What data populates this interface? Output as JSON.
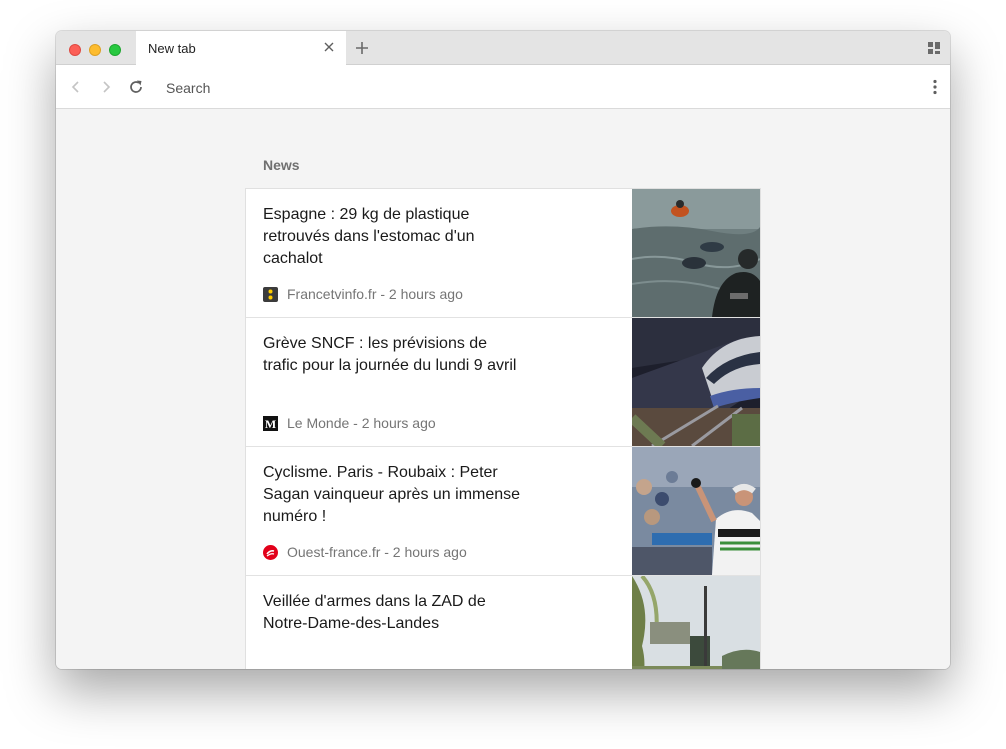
{
  "browser": {
    "active_tab_title": "New tab",
    "search_placeholder": "Search"
  },
  "news": {
    "section_title": "News",
    "articles": [
      {
        "headline": "Espagne : 29 kg de plastique retrouvés dans l'estomac d'un cachalot",
        "source": "Francetvinfo.fr - 2 hours ago",
        "favicon": "francetvinfo-icon",
        "thumbnail": "divers-in-water-image"
      },
      {
        "headline": "Grève SNCF : les prévisions de trafic pour la journée du lundi 9 avril",
        "source": "Le Monde - 2 hours ago",
        "favicon": "le-monde-icon",
        "thumbnail": "tgv-train-image"
      },
      {
        "headline": "Cyclisme. Paris - Roubaix : Peter Sagan vainqueur après un immense numéro !",
        "source": "Ouest-france.fr - 2 hours ago",
        "favicon": "ouest-france-icon",
        "thumbnail": "cyclist-celebrating-image"
      },
      {
        "headline": "Veillée d'armes dans la ZAD de Notre-Dame-des-Landes",
        "source": "",
        "favicon": "",
        "thumbnail": "zad-trees-image"
      }
    ]
  },
  "colors": {
    "traffic_red": "#fc5f57",
    "traffic_yellow": "#fdbc2e",
    "traffic_green": "#28c840",
    "ouest_france_red": "#e2001a"
  }
}
